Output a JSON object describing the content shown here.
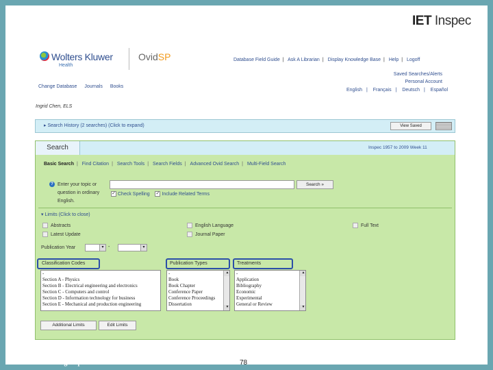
{
  "branding": {
    "iet_prefix": "IET",
    "iet_product": "Inspec",
    "wk_name": "Wolters Kluwer",
    "wk_sub": "Health",
    "ovid_prefix": "Ovid",
    "ovid_suffix": "SP"
  },
  "top_links": [
    "Database Field Guide",
    "Ask A Librarian",
    "Display Knowledge Base",
    "Help",
    "Logoff"
  ],
  "right_links": [
    "Saved Searches/Alerts",
    "Personal Account"
  ],
  "nav_links": [
    "Change Database",
    "Journals",
    "Books"
  ],
  "languages": [
    "English",
    "Français",
    "Deutsch",
    "Español"
  ],
  "user": "Ingrid Chen, ELS",
  "search_history": {
    "label": "Search History (2 searches) (Click to expand)",
    "view_saved": "View Saved"
  },
  "search_tab": "Search",
  "database": "Inspec 1957 to 2009 Week 11",
  "subtabs": [
    "Basic Search",
    "Find Citation",
    "Search Tools",
    "Search Fields",
    "Advanced Ovid Search",
    "Multi-Field Search"
  ],
  "basic": {
    "prompt": "Enter your topic or question in ordinary English.",
    "search_button": "Search »",
    "check_spelling": "Check Spelling",
    "include_related": "Include Related Terms"
  },
  "limits": {
    "header": "Limits (Click to close)",
    "abstracts": "Abstracts",
    "latest_update": "Latest Update",
    "english_language": "English Language",
    "journal_paper": "Journal Paper",
    "full_text": "Full Text",
    "publication_year": "Publication Year"
  },
  "lists": {
    "classification_label": "Classification Codes",
    "classification_items": [
      "-",
      "Section A - Physics",
      "Section B - Electrical engineering and electronics",
      "Section C - Computers and control",
      "Section D - Information technology for business",
      "Section E - Mechanical and production engineering"
    ],
    "pubtypes_label": "Publication Types",
    "pubtypes_items": [
      "-",
      "Book",
      "Book Chapter",
      "Conference Paper",
      "Conference Proceedings",
      "Dissertation"
    ],
    "treatments_label": "Treatments",
    "treatments_items": [
      "-",
      "Application",
      "Bibliography",
      "Economic",
      "Experimental",
      "General or Review"
    ]
  },
  "buttons": {
    "additional_limits": "Additional Limits",
    "edit_limits": "Edit Limits"
  },
  "footer": {
    "url": "www.theiet.org/inspec",
    "page": "78"
  }
}
